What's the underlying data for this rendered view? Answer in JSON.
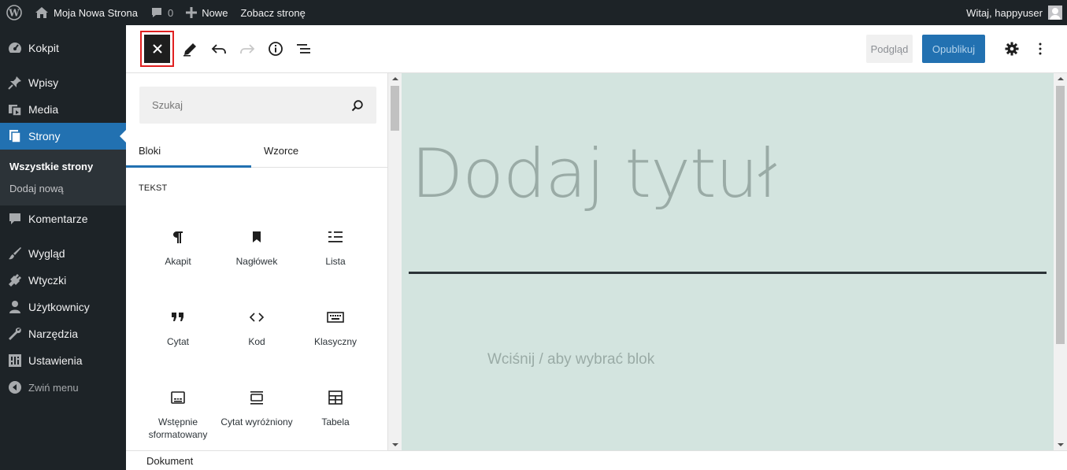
{
  "adminbar": {
    "site_name": "Moja Nowa Strona",
    "comments_count": "0",
    "new_label": "Nowe",
    "view_page": "Zobacz stronę",
    "greeting": "Witaj, happyuser"
  },
  "sidebar": {
    "items": [
      {
        "label": "Kokpit",
        "icon": "dashboard-icon"
      },
      {
        "label": "Wpisy",
        "icon": "pin-icon"
      },
      {
        "label": "Media",
        "icon": "media-icon"
      },
      {
        "label": "Strony",
        "icon": "pages-icon"
      },
      {
        "label": "Komentarze",
        "icon": "comment-icon"
      },
      {
        "label": "Wygląd",
        "icon": "brush-icon"
      },
      {
        "label": "Wtyczki",
        "icon": "plugin-icon"
      },
      {
        "label": "Użytkownicy",
        "icon": "users-icon"
      },
      {
        "label": "Narzędzia",
        "icon": "wrench-icon"
      },
      {
        "label": "Ustawienia",
        "icon": "settings-icon"
      }
    ],
    "submenu": [
      "Wszystkie strony",
      "Dodaj nową"
    ],
    "collapse": "Zwiń menu"
  },
  "toolbar": {
    "preview": "Podgląd",
    "publish": "Opublikuj"
  },
  "inserter": {
    "search_placeholder": "Szukaj",
    "tabs": [
      "Bloki",
      "Wzorce"
    ],
    "category": "Tekst",
    "blocks": [
      {
        "label": "Akapit",
        "icon": "paragraph-icon"
      },
      {
        "label": "Nagłówek",
        "icon": "bookmark-icon"
      },
      {
        "label": "Lista",
        "icon": "list-icon"
      },
      {
        "label": "Cytat",
        "icon": "quote-icon"
      },
      {
        "label": "Kod",
        "icon": "code-icon"
      },
      {
        "label": "Klasyczny",
        "icon": "keyboard-icon"
      },
      {
        "label": "Wstępnie sformatowany",
        "icon": "preformatted-icon"
      },
      {
        "label": "Cytat wyróżniony",
        "icon": "pullquote-icon"
      },
      {
        "label": "Tabela",
        "icon": "table-icon"
      }
    ]
  },
  "canvas": {
    "title_placeholder": "Dodaj tytuł",
    "block_placeholder": "Wciśnij / aby wybrać blok"
  },
  "footer": {
    "breadcrumb": "Dokument"
  },
  "colors": {
    "admin_dark": "#1d2327",
    "accent": "#2271b1",
    "canvas_bg": "#d3e4df",
    "highlight": "#e02020"
  }
}
